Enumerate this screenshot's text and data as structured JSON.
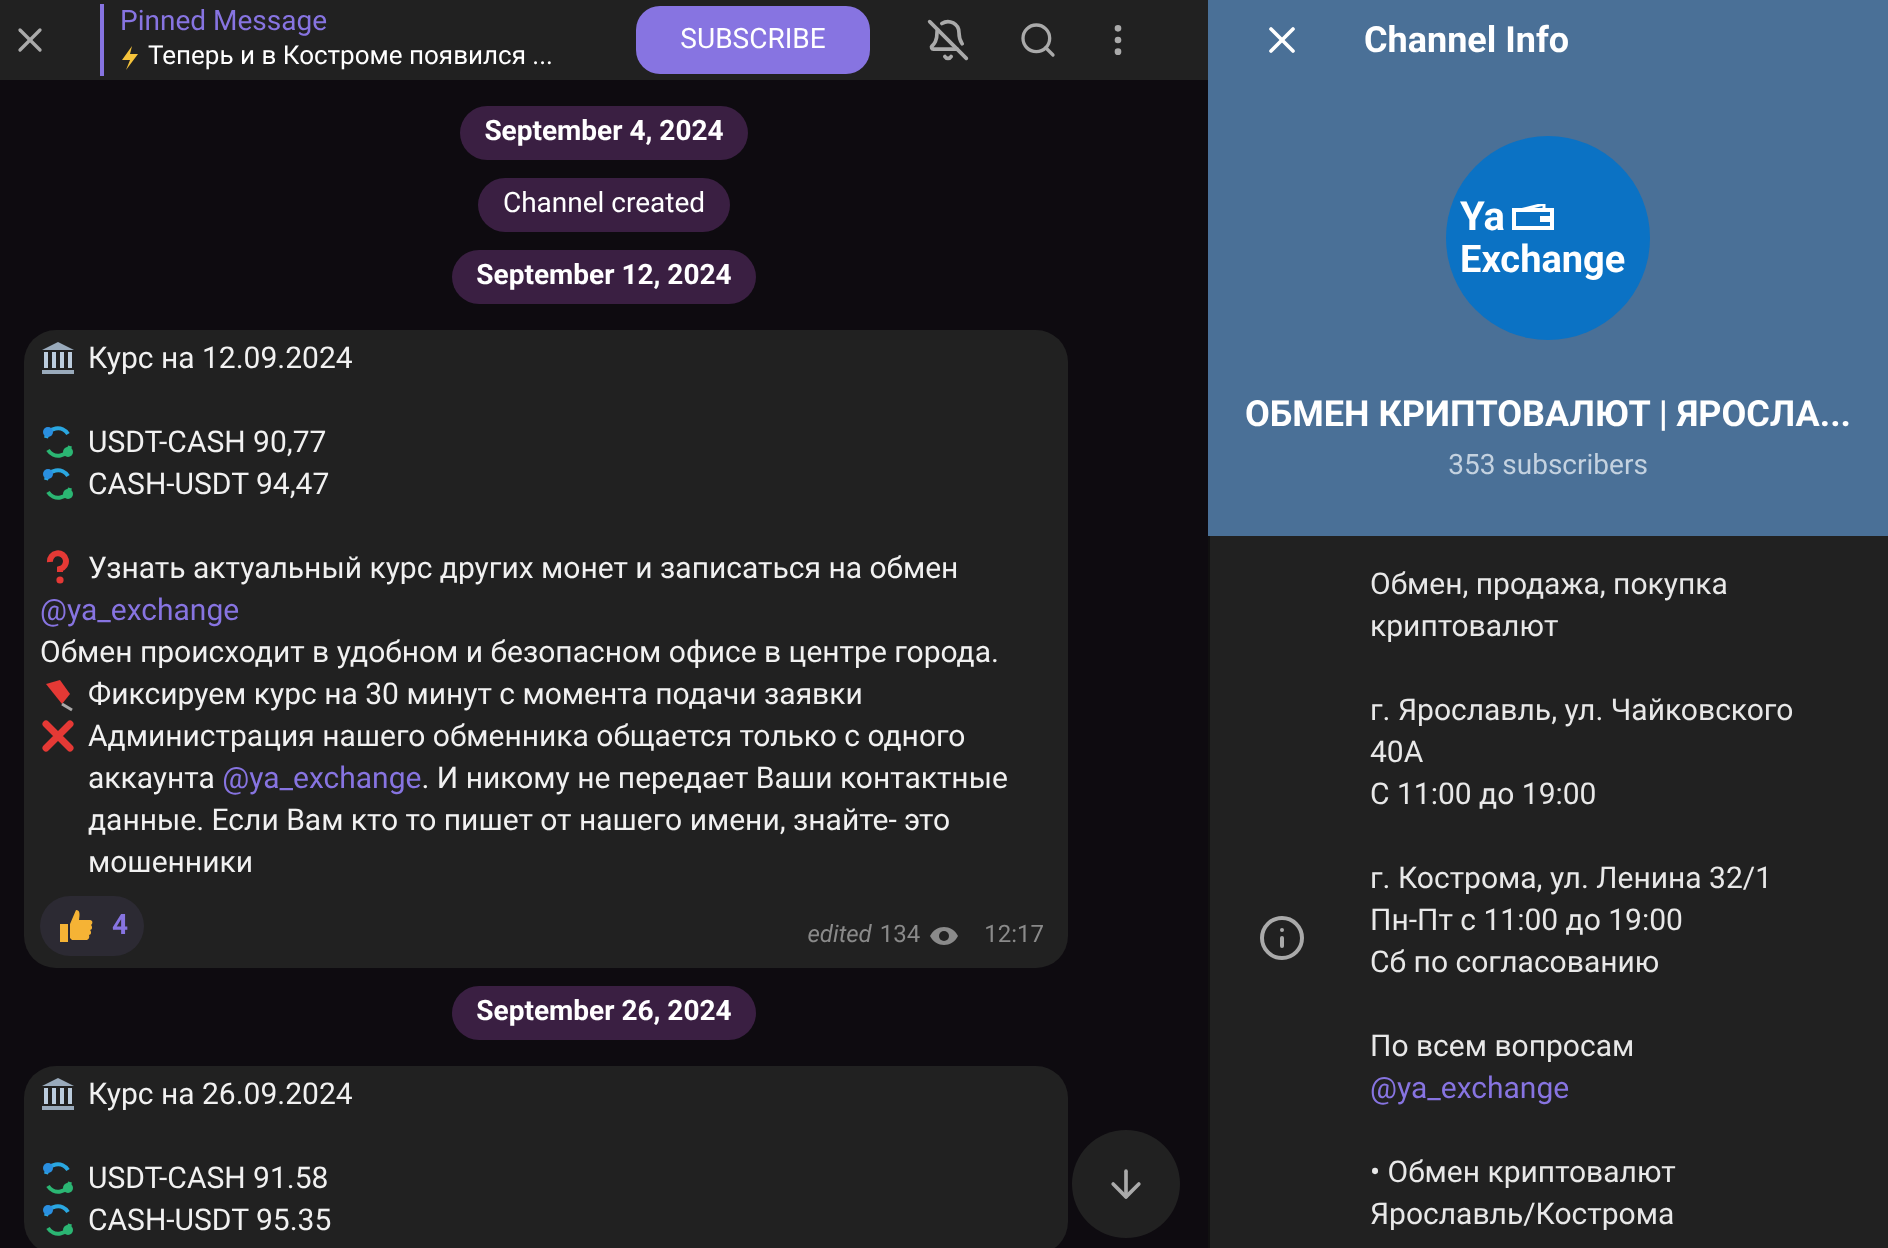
{
  "header": {
    "pinned": {
      "title": "Pinned Message",
      "text": "Теперь и в Костроме появился ..."
    },
    "subscribe": "SUBSCRIBE"
  },
  "chat": [
    {
      "kind": "date",
      "text": "September 4, 2024"
    },
    {
      "kind": "service",
      "text": "Channel created"
    },
    {
      "kind": "date",
      "text": "September 12, 2024"
    },
    {
      "kind": "message",
      "paragraphs": [
        [
          {
            "kind": "bank",
            "segments": [
              {
                "kind": "text",
                "text": "Курс на 12.09.2024"
              }
            ]
          }
        ],
        [
          {
            "kind": "exchange",
            "segments": [
              {
                "kind": "text",
                "text": "USDT-CASH 90,77"
              }
            ]
          },
          {
            "kind": "exchange",
            "segments": [
              {
                "kind": "text",
                "text": "CASH-USDT 94,47"
              }
            ]
          }
        ],
        [
          {
            "kind": "question",
            "segments": [
              {
                "kind": "text",
                "text": "Узнать актуальный курс других монет и записаться на обмен"
              }
            ]
          },
          {
            "kind": "plain",
            "segments": [
              {
                "kind": "mention",
                "text": "@ya_exchange"
              }
            ]
          },
          {
            "kind": "plain",
            "segments": [
              {
                "kind": "text",
                "text": "Обмен происходит в удобном и безопасном офисе в центре города."
              }
            ]
          },
          {
            "kind": "pin",
            "segments": [
              {
                "kind": "text",
                "text": "Фиксируем курс на 30 минут с момента подачи заявки"
              }
            ]
          },
          {
            "kind": "cross",
            "segments": [
              {
                "kind": "text",
                "text": "Администрация нашего обменника общается только с одного аккаунта "
              },
              {
                "kind": "mention",
                "text": "@ya_exchange"
              },
              {
                "kind": "text",
                "text": ". И никому не передает Ваши контактные данные. Если Вам кто то пишет от нашего имени, знайте- это мошенники"
              }
            ]
          }
        ]
      ],
      "reactions": [
        {
          "kind": "thumbs-up",
          "count": "4",
          "selected": false
        }
      ],
      "footer": {
        "edited": "edited",
        "views": "134",
        "time": "12:17"
      }
    },
    {
      "kind": "date",
      "text": "September 26, 2024"
    },
    {
      "kind": "message",
      "paragraphs": [
        [
          {
            "kind": "bank",
            "segments": [
              {
                "kind": "text",
                "text": "Курс на 26.09.2024"
              }
            ]
          }
        ],
        [
          {
            "kind": "exchange",
            "segments": [
              {
                "kind": "text",
                "text": "USDT-CASH 91.58"
              }
            ]
          },
          {
            "kind": "exchange",
            "segments": [
              {
                "kind": "text",
                "text": "CASH-USDT 95.35"
              }
            ]
          }
        ]
      ]
    }
  ],
  "info": {
    "title": "Channel Info",
    "logo": {
      "line1": "Ya",
      "line2": "Exchange"
    },
    "name": "ОБМЕН КРИПТОВАЛЮТ | ЯРОСЛА...",
    "subscribers": "353 subscribers",
    "description": [
      [
        {
          "segments": [
            {
              "kind": "text",
              "text": "Обмен, продажа, покупка криптовалют"
            }
          ]
        }
      ],
      [
        {
          "segments": [
            {
              "kind": "text",
              "text": "г. Ярославль, ул. Чайковского 40А"
            }
          ]
        },
        {
          "segments": [
            {
              "kind": "text",
              "text": "С 11:00 до 19:00"
            }
          ]
        }
      ],
      [
        {
          "segments": [
            {
              "kind": "text",
              "text": "г. Кострома, ул. Ленина 32/1"
            }
          ]
        },
        {
          "segments": [
            {
              "kind": "text",
              "text": "Пн-Пт с 11:00 до 19:00"
            }
          ]
        },
        {
          "segments": [
            {
              "kind": "text",
              "text": "Сб по согласованию"
            }
          ]
        }
      ],
      [
        {
          "segments": [
            {
              "kind": "text",
              "text": "По всем вопросам"
            }
          ]
        },
        {
          "segments": [
            {
              "kind": "mention",
              "text": "@ya_exchange"
            }
          ]
        }
      ],
      [
        {
          "segments": [
            {
              "kind": "text",
              "text": "• Обмен криптовалют"
            }
          ]
        },
        {
          "segments": [
            {
              "kind": "text",
              "text": "Ярославль/Кострома"
            }
          ]
        }
      ]
    ]
  }
}
